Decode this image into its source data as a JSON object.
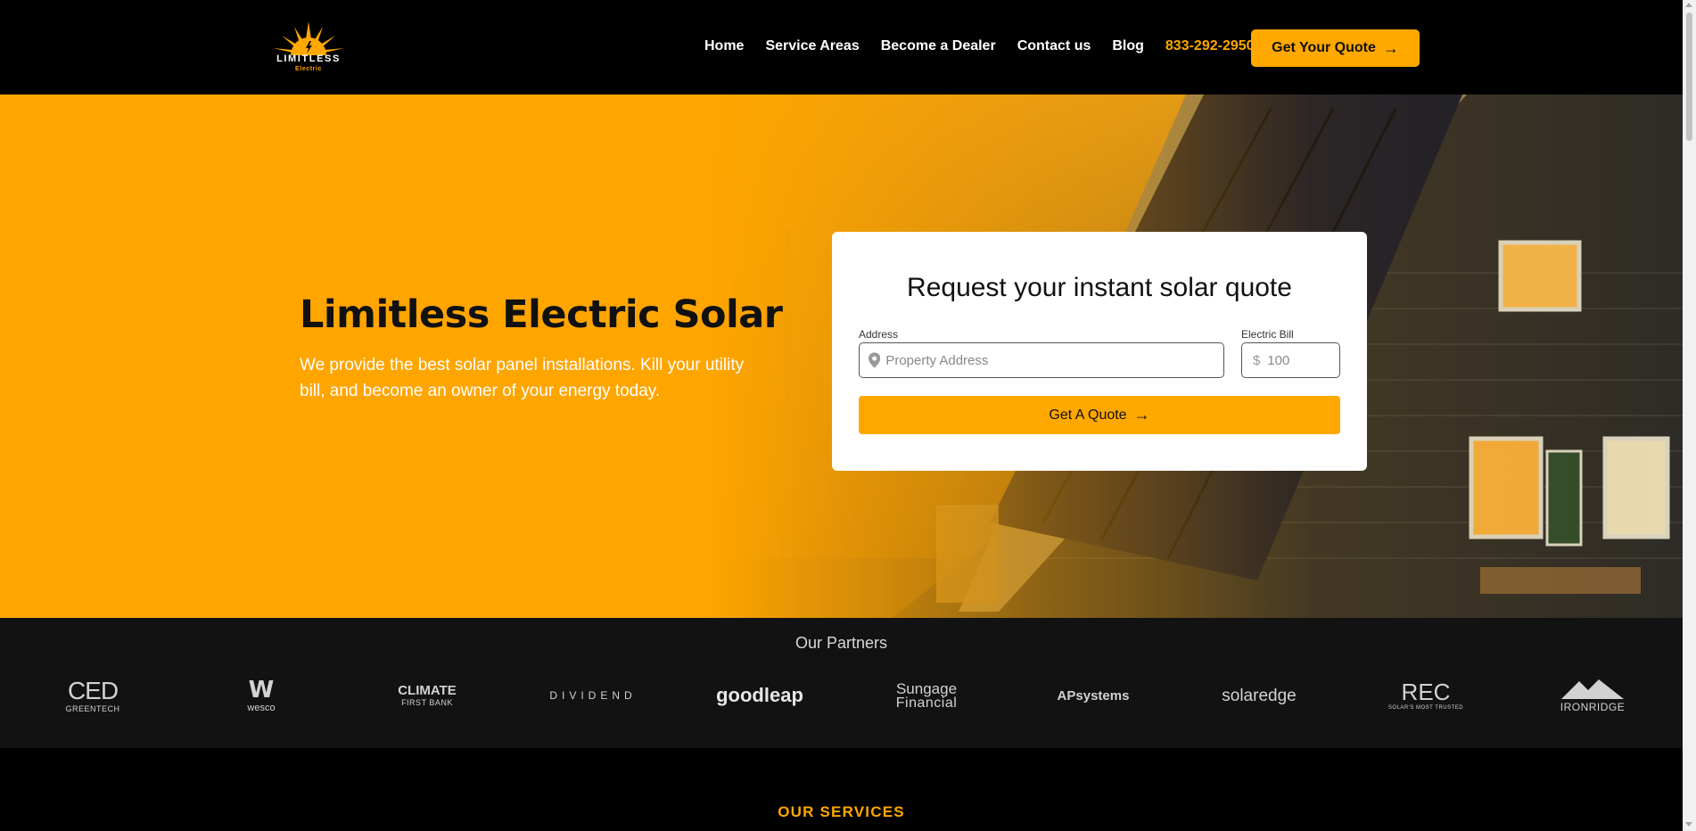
{
  "brand": {
    "logo_word": "LIMITLESS",
    "logo_sub": "Electric",
    "accent_color": "#ffa800",
    "logo_icon": "sunburst-icon"
  },
  "nav": {
    "items": [
      "Home",
      "Service Areas",
      "Become a Dealer",
      "Contact us",
      "Blog"
    ],
    "phone": "833-292-2950",
    "cta_label": "Get Your Quote",
    "cta_icon": "arrow-right-icon"
  },
  "hero": {
    "title": "Limitless Electric Solar",
    "subtitle": "We provide the best solar panel installations. Kill your utility bill, and become an owner of your energy today.",
    "background_color": "#ffa500"
  },
  "quote_form": {
    "title": "Request your instant solar quote",
    "address_label": "Address",
    "address_placeholder": "Property Address",
    "address_icon": "map-pin-icon",
    "bill_label": "Electric Bill",
    "bill_currency": "$",
    "bill_placeholder": "100",
    "submit_label": "Get A Quote",
    "submit_icon": "arrow-right-icon"
  },
  "partners": {
    "title": "Our Partners",
    "logos": [
      {
        "main": "CED",
        "sub": "GREENTECH"
      },
      {
        "main": "W",
        "sub": "wesco"
      },
      {
        "main": "CLIMATE",
        "sub": "FIRST BANK"
      },
      {
        "main": "DIVIDEND",
        "sub": ""
      },
      {
        "main": "goodleap",
        "sub": ""
      },
      {
        "main": "Sungage",
        "sub": "Financial"
      },
      {
        "main": "APsystems",
        "sub": ""
      },
      {
        "main": "solaredge",
        "sub": ""
      },
      {
        "main": "REC",
        "sub": "SOLAR'S MOST TRUSTED"
      },
      {
        "main": "IRONRIDGE",
        "sub": ""
      }
    ]
  },
  "services": {
    "title": "OUR SERVICES"
  }
}
